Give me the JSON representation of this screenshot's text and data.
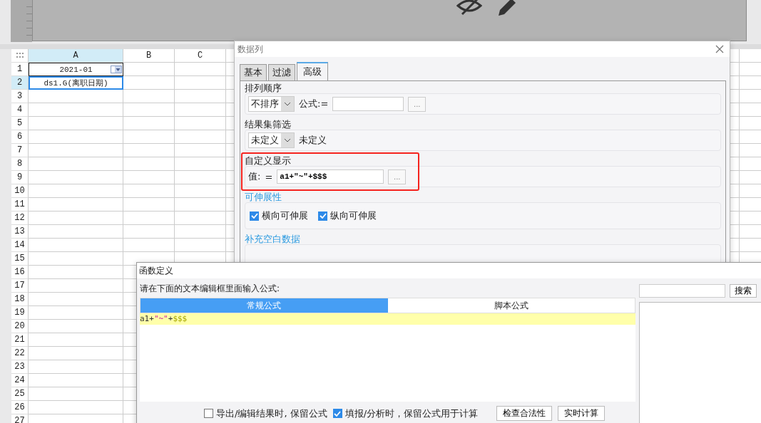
{
  "sheet": {
    "columns": [
      {
        "label": "A",
        "selected": true
      },
      {
        "label": "B",
        "selected": false
      },
      {
        "label": "C",
        "selected": false
      }
    ],
    "rows": [
      {
        "label": "1",
        "selected": false,
        "cells": [
          {
            "text": "2021-01",
            "kind": "dropdown",
            "selected": false
          }
        ]
      },
      {
        "label": "2",
        "selected": true,
        "cells": [
          {
            "text": "ds1.G(离职日期)",
            "kind": "text",
            "selected": true
          }
        ]
      },
      {
        "label": "3",
        "selected": false
      },
      {
        "label": "4",
        "selected": false
      },
      {
        "label": "5",
        "selected": false
      },
      {
        "label": "6",
        "selected": false
      },
      {
        "label": "7",
        "selected": false
      },
      {
        "label": "8",
        "selected": false
      },
      {
        "label": "9",
        "selected": false
      },
      {
        "label": "10",
        "selected": false
      },
      {
        "label": "11",
        "selected": false
      },
      {
        "label": "12",
        "selected": false
      },
      {
        "label": "13",
        "selected": false
      },
      {
        "label": "14",
        "selected": false
      },
      {
        "label": "15",
        "selected": false
      },
      {
        "label": "16",
        "selected": false
      },
      {
        "label": "17",
        "selected": false
      },
      {
        "label": "18",
        "selected": false
      },
      {
        "label": "19",
        "selected": false
      },
      {
        "label": "20",
        "selected": false
      },
      {
        "label": "21",
        "selected": false
      },
      {
        "label": "22",
        "selected": false
      },
      {
        "label": "23",
        "selected": false
      },
      {
        "label": "24",
        "selected": false
      },
      {
        "label": "25",
        "selected": false
      },
      {
        "label": "26",
        "selected": false
      },
      {
        "label": "27",
        "selected": false
      }
    ]
  },
  "column_dialog": {
    "title": "数据列",
    "tabs": [
      {
        "label": "基本",
        "selected": false
      },
      {
        "label": "过滤",
        "selected": false
      },
      {
        "label": "高级",
        "selected": true
      }
    ],
    "sections": [
      {
        "kind": "sort",
        "title": "排列顺序",
        "accent": false,
        "highlighted": false,
        "select": "不排序",
        "formula_label": "公式:=",
        "button": "..."
      },
      {
        "kind": "filter",
        "title": "结果集筛选",
        "accent": false,
        "highlighted": false,
        "select": "未定义",
        "note": "未定义"
      },
      {
        "kind": "custom",
        "title": "自定义显示",
        "accent": false,
        "highlighted": true,
        "value_label": "值:",
        "equals": "=",
        "value": "a1+\"~\"+$$$",
        "button": "..."
      },
      {
        "kind": "checks",
        "title": "可伸展性",
        "accent": true,
        "highlighted": false,
        "options": [
          {
            "label": "横向可伸展",
            "checked": true
          },
          {
            "label": "纵向可伸展",
            "checked": true
          }
        ]
      },
      {
        "kind": "empty",
        "title": "补充空白数据",
        "accent": true,
        "highlighted": false
      }
    ]
  },
  "formula_dialog": {
    "title": "函数定义",
    "prompt": "请在下面的文本编辑框里面输入公式:",
    "tabs": [
      {
        "label": "常规公式",
        "selected": true
      },
      {
        "label": "脚本公式",
        "selected": false
      }
    ],
    "code": [
      {
        "text": "a1+",
        "kind": "plain"
      },
      {
        "text": "\"~\"",
        "kind": "string"
      },
      {
        "text": "+",
        "kind": "plain"
      },
      {
        "text": "$$$",
        "kind": "variable"
      }
    ],
    "search_button": "搜索",
    "options": [
      {
        "label": "导出/编辑结果时, 保留公式",
        "checked": false
      },
      {
        "label": "填报/分析时，保留公式用于计算",
        "checked": true
      }
    ],
    "buttons": [
      "检查合法性",
      "实时计算"
    ]
  }
}
